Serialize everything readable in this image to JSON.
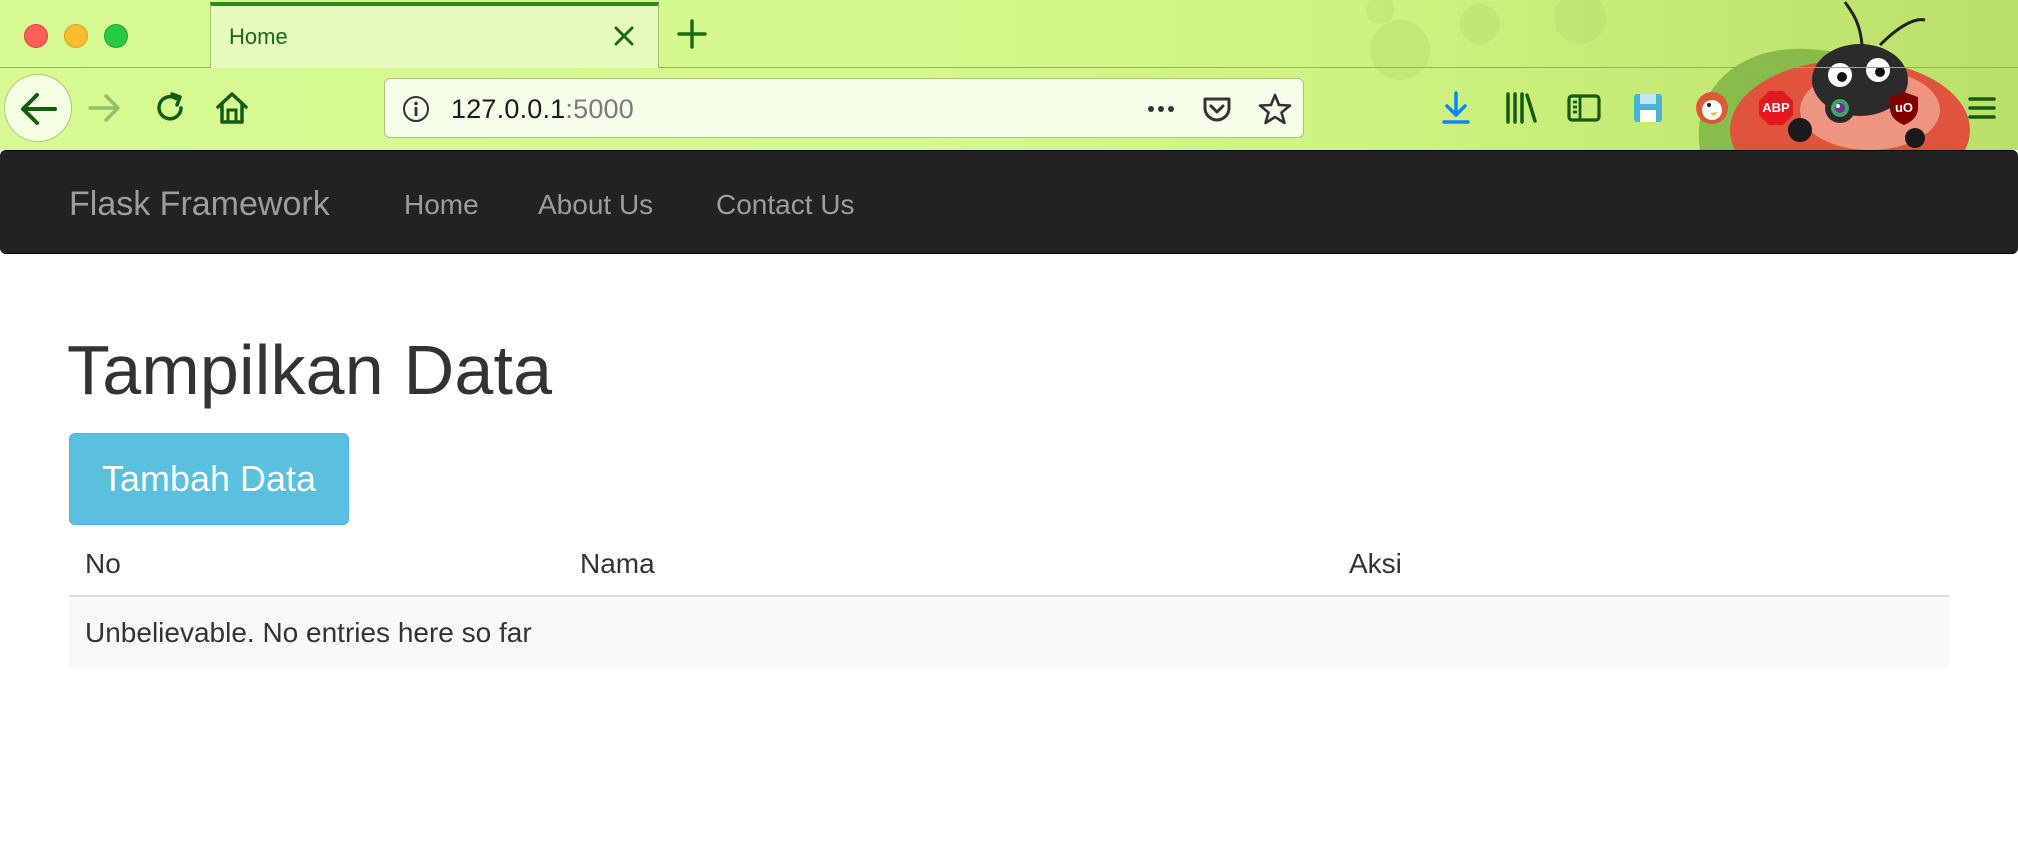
{
  "browser": {
    "tab": {
      "title": "Home"
    },
    "url": {
      "host": "127.0.0.1",
      "port": ":5000"
    },
    "icons": {
      "back": "back-arrow-icon",
      "forward": "forward-arrow-icon",
      "reload": "reload-icon",
      "home": "home-icon",
      "info": "info-icon",
      "more": "more-icon",
      "pocket": "pocket-icon",
      "bookmark": "star-icon",
      "toolbar": [
        "download-icon",
        "library-icon",
        "sidebar-icon",
        "save-icon",
        "duckduckgo-icon",
        "adblock-plus-icon",
        "eye-extension-icon",
        "ublock-icon",
        "menu-icon"
      ]
    },
    "abp_badge": "ABP",
    "ublock_badge": "uO",
    "theme_color": "#d4f98c"
  },
  "site": {
    "brand": "Flask Framework",
    "nav": {
      "home": "Home",
      "about": "About Us",
      "contact": "Contact Us"
    },
    "navbar_color": "#222222"
  },
  "main": {
    "title": "Tampilkan Data",
    "add_button": "Tambah Data",
    "button_color": "#5bc0de",
    "table": {
      "headers": [
        "No",
        "Nama",
        "Aksi"
      ],
      "empty_message": "Unbelievable. No entries here so far"
    }
  }
}
